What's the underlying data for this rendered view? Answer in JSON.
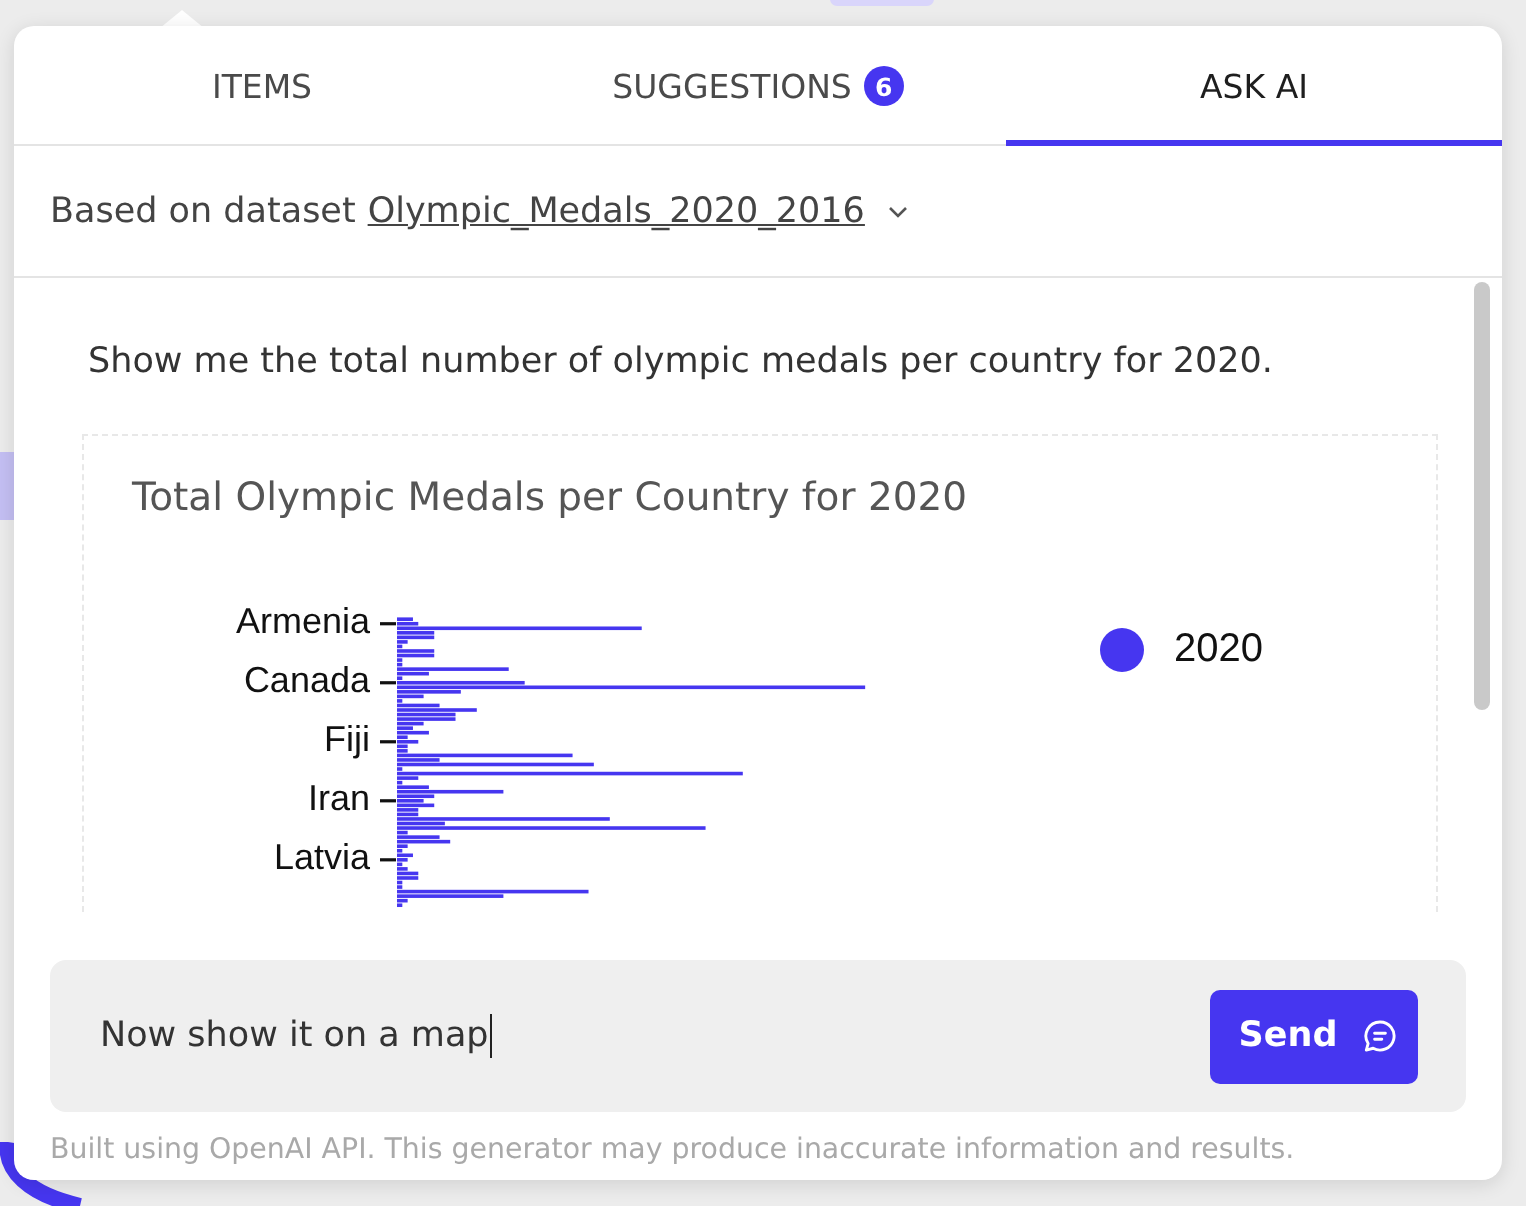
{
  "tabs": [
    {
      "label": "ITEMS",
      "selected": false
    },
    {
      "label": "SUGGESTIONS",
      "badge": "6",
      "selected": false
    },
    {
      "label": "ASK AI",
      "selected": true
    }
  ],
  "dataset": {
    "prefix": "Based on dataset",
    "name": "Olympic_Medals_2020_2016"
  },
  "conversation": {
    "prompt": "Show me the total number of olympic medals per country for 2020.",
    "chart": {
      "title": "Total Olympic Medals per Country for 2020",
      "y_labels": [
        "Armenia",
        "Canada",
        "Fiji",
        "Iran",
        "Latvia"
      ],
      "legend": [
        "2020"
      ]
    }
  },
  "composer": {
    "value": "Now show it on a map",
    "send_label": "Send"
  },
  "footer": "Built using OpenAI API. This generator may produce inaccurate information and results."
}
